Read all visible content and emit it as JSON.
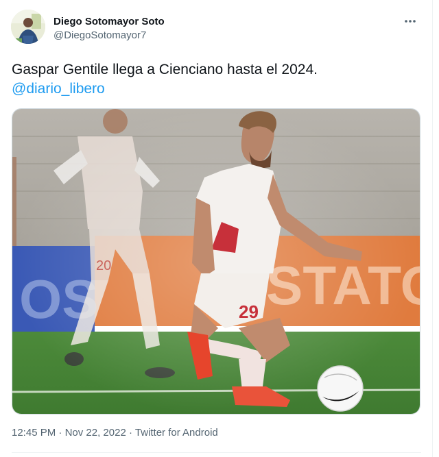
{
  "tweet": {
    "author": {
      "display_name": "Diego Sotomayor Soto",
      "handle": "@DiegoSotomayor7",
      "avatar_icon": "user-avatar"
    },
    "more_icon": "more-options-icon",
    "text": "Gaspar Gentile llega a Cienciano hasta el 2024.",
    "mention": "@diario_libero",
    "media": {
      "description_icon": "football-photo",
      "jersey_numbers": [
        "20",
        "29"
      ]
    },
    "meta": {
      "time": "12:45 PM",
      "separator": " · ",
      "date": "Nov 22, 2022",
      "source": "Twitter for Android"
    }
  },
  "colors": {
    "link": "#1d9bf0",
    "secondary_text": "#536471",
    "primary_text": "#0f1419",
    "border": "#cfd9de"
  }
}
